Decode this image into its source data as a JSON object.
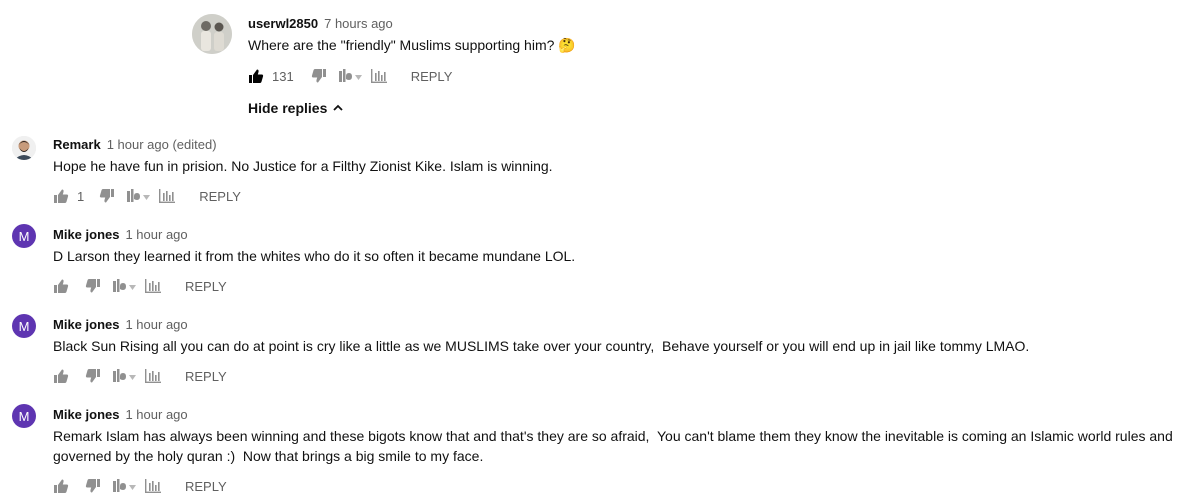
{
  "comments": [
    {
      "author": "userwl2850",
      "time": "7 hours ago",
      "text": "Where are the \"friendly\" Muslims supporting him?",
      "emoji": "🤔",
      "likes": "131",
      "reply_label": "REPLY",
      "liked": true
    },
    {
      "author": "Remark",
      "time": "1 hour ago (edited)",
      "text": "Hope he have fun in prision. No Justice for a Filthy Zionist Kike. Islam is winning.",
      "likes": "1",
      "reply_label": "REPLY"
    },
    {
      "author": "Mike jones",
      "avatar_letter": "M",
      "time": "1 hour ago",
      "text": "D Larson they learned it from the whites who do it so often it became mundane LOL.",
      "reply_label": "REPLY"
    },
    {
      "author": "Mike jones",
      "avatar_letter": "M",
      "time": "1 hour ago",
      "text": "Black Sun Rising all you can do at point is cry like a little as we MUSLIMS take over your country,  Behave yourself or you will end up in jail like tommy LMAO.",
      "reply_label": "REPLY"
    },
    {
      "author": "Mike jones",
      "avatar_letter": "M",
      "time": "1 hour ago",
      "text": "Remark Islam has always been winning and these bigots know that and that's they are so afraid,  You can't blame them they know the inevitable is coming an Islamic world rules and governed by the holy quran :)  Now that brings a big smile to my face.",
      "reply_label": "REPLY"
    }
  ],
  "hide_replies_label": "Hide replies",
  "colors": {
    "avatar_purple": "#5e35b1",
    "icon_gray": "#909090",
    "icon_dark": "#030303"
  }
}
